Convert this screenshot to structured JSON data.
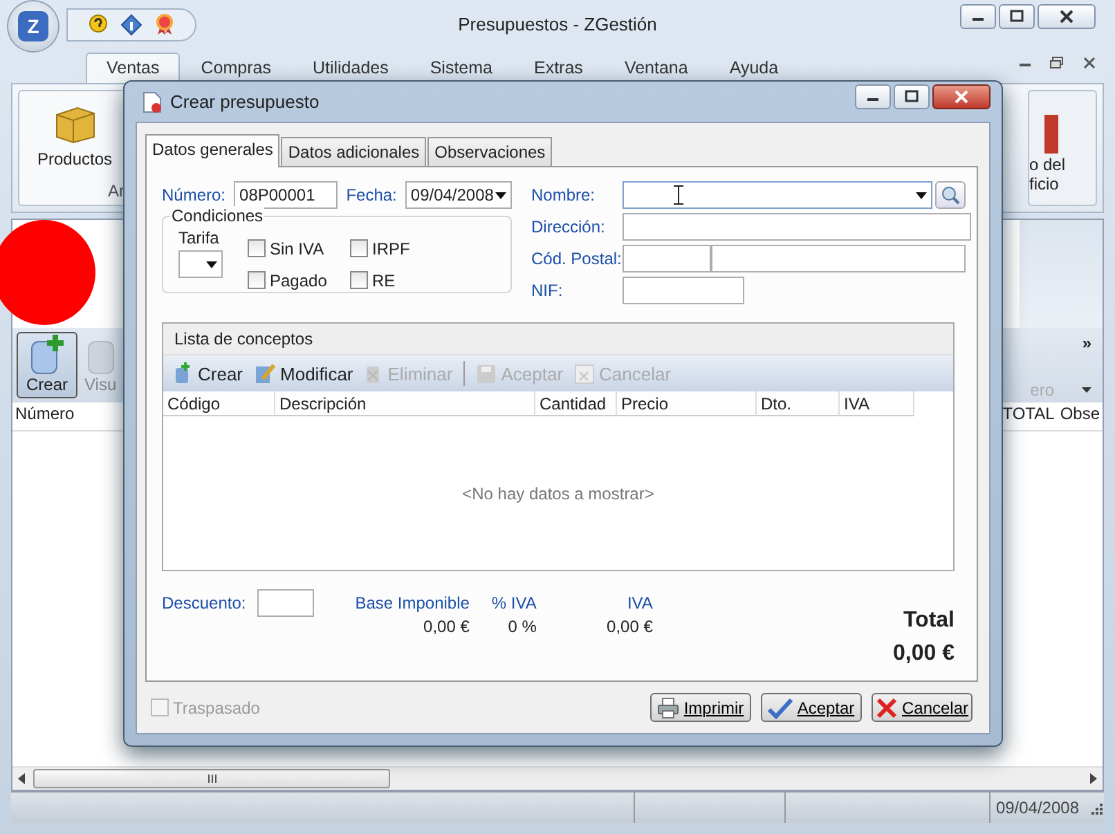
{
  "window": {
    "title": "Presupuestos - ZGestión",
    "logo": "Z",
    "status_date": "09/04/2008"
  },
  "ribbon_tabs": [
    {
      "label": "Ventas",
      "selected": true
    },
    {
      "label": "Compras",
      "selected": false
    },
    {
      "label": "Utilidades",
      "selected": false
    },
    {
      "label": "Sistema",
      "selected": false
    },
    {
      "label": "Extras",
      "selected": false
    },
    {
      "label": "Ventana",
      "selected": false
    },
    {
      "label": "Ayuda",
      "selected": false
    }
  ],
  "ribbon": {
    "left_button": "Productos",
    "left_group": "Ar",
    "right_button_lines": [
      "o del",
      "ficio"
    ]
  },
  "toolbar": {
    "left_buttons": [
      {
        "label": "Crear",
        "disabled": false
      },
      {
        "label": "Visu",
        "disabled": true
      }
    ],
    "overflow": "»",
    "right_button": {
      "label": "ero",
      "disabled": true
    }
  },
  "grid": {
    "left_columns": [
      "Número"
    ],
    "right_columns": [
      "TOTAL",
      "Obse"
    ]
  },
  "dialog": {
    "title": "Crear presupuesto",
    "tabs": [
      {
        "label": "Datos generales",
        "selected": true
      },
      {
        "label": "Datos adicionales",
        "selected": false
      },
      {
        "label": "Observaciones",
        "selected": false
      }
    ],
    "numero": {
      "label": "Número:",
      "value": "08P00001"
    },
    "fecha": {
      "label": "Fecha:",
      "value": "09/04/2008"
    },
    "condiciones": {
      "title": "Condiciones",
      "tarifa_label": "Tarifa",
      "checks": [
        {
          "label": "Sin IVA",
          "checked": false
        },
        {
          "label": "IRPF",
          "checked": false
        },
        {
          "label": "Pagado",
          "checked": false
        },
        {
          "label": "RE",
          "checked": false
        }
      ]
    },
    "nombre": {
      "label": "Nombre:"
    },
    "direccion": {
      "label": "Dirección:"
    },
    "cod_postal": {
      "label": "Cód. Postal:"
    },
    "nif": {
      "label": "NIF:"
    },
    "conceptos": {
      "title": "Lista de conceptos",
      "actions": [
        {
          "label": "Crear",
          "disabled": false
        },
        {
          "label": "Modificar",
          "disabled": false
        },
        {
          "label": "Eliminar",
          "disabled": true
        },
        {
          "label": "Aceptar",
          "disabled": true
        },
        {
          "label": "Cancelar",
          "disabled": true
        }
      ],
      "columns": [
        "Código",
        "Descripción",
        "Cantidad",
        "Precio",
        "Dto.",
        "IVA"
      ],
      "empty": "<No hay datos a mostrar>"
    },
    "descuento": {
      "label": "Descuento:"
    },
    "totals": [
      {
        "label": "Base Imponible",
        "value": "0,00 €"
      },
      {
        "label": "% IVA",
        "value": "0 %"
      },
      {
        "label": "IVA",
        "value": "0,00 €"
      }
    ],
    "total": {
      "label": "Total",
      "value": "0,00 €"
    },
    "traspasado": {
      "label": "Traspasado",
      "checked": false,
      "disabled": true
    },
    "buttons": [
      {
        "kind": "print",
        "label": "Imprimir"
      },
      {
        "kind": "ok",
        "label": "Aceptar"
      },
      {
        "kind": "cancel",
        "label": "Cancelar"
      }
    ]
  }
}
